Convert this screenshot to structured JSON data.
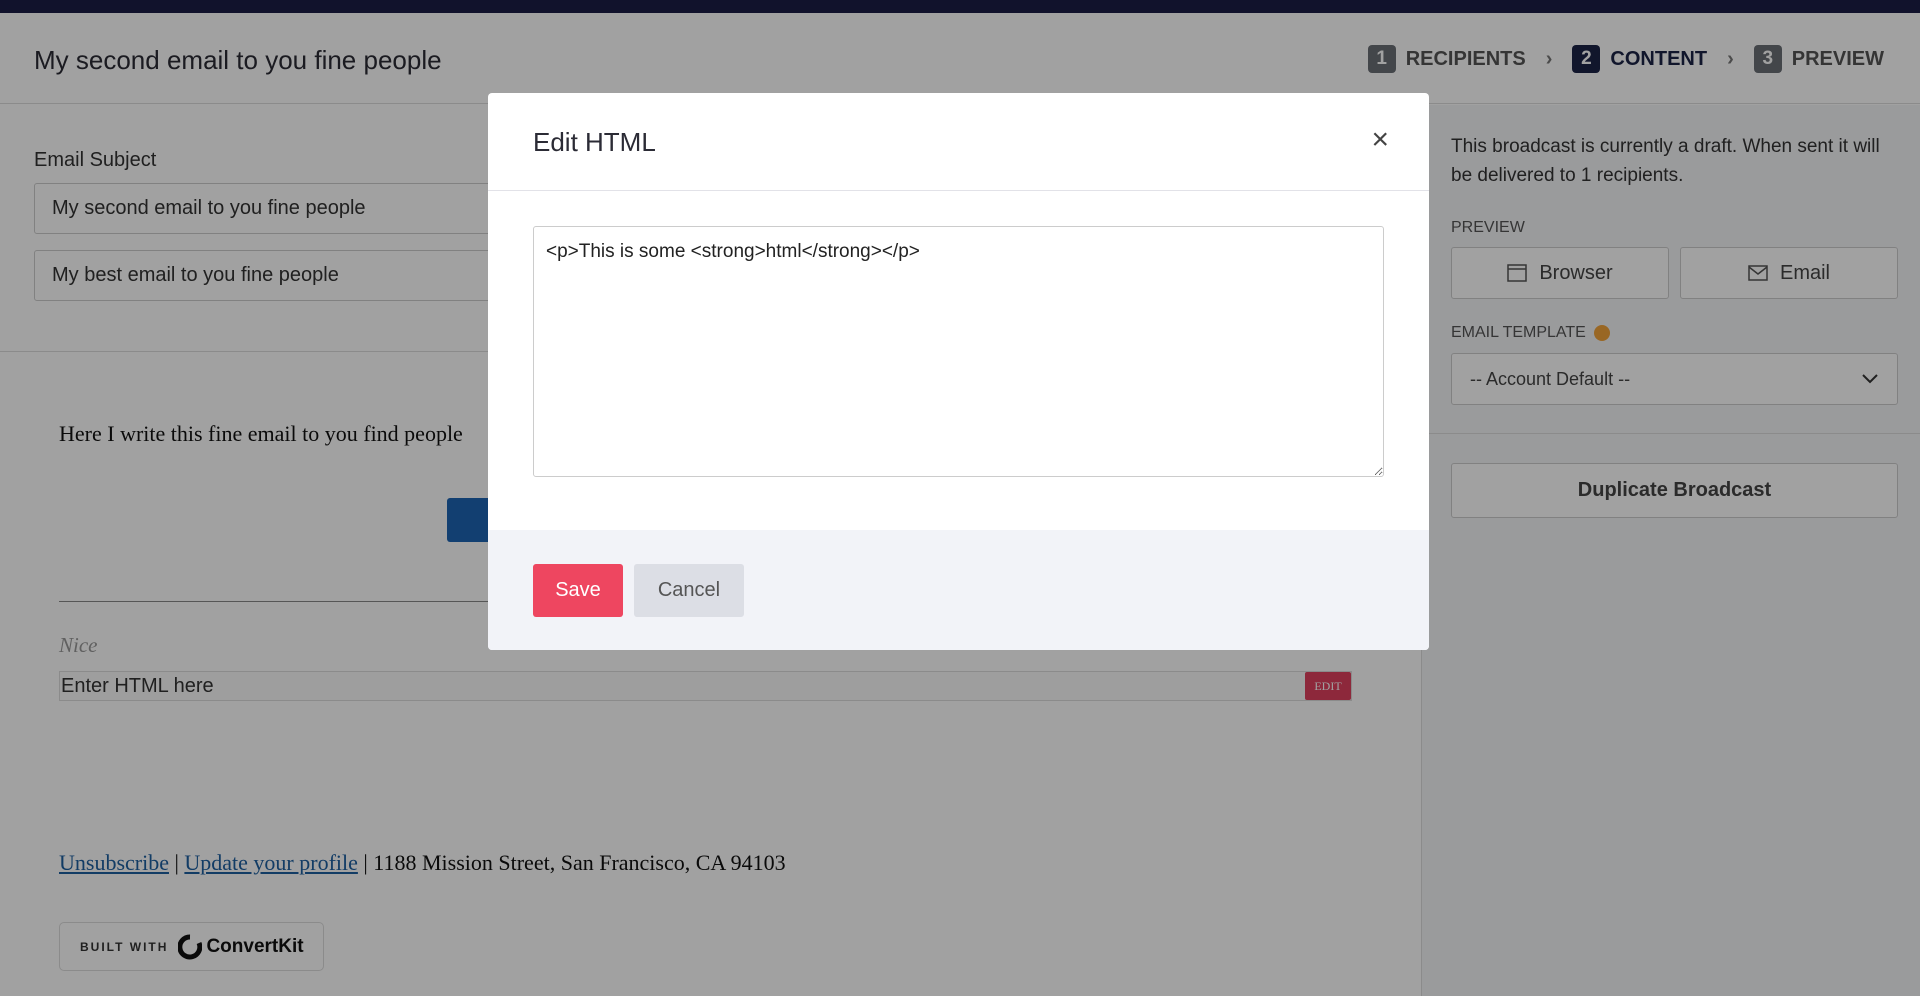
{
  "header": {
    "title": "My second email to you fine people",
    "steps": [
      {
        "num": "1",
        "label": "RECIPIENTS"
      },
      {
        "num": "2",
        "label": "CONTENT"
      },
      {
        "num": "3",
        "label": "PREVIEW"
      }
    ],
    "active_step": "CONTENT"
  },
  "main": {
    "subject_label": "Email Subject",
    "subject_value": "My second email to you fine people",
    "preview_text_value": "My best email to you fine people",
    "body_text": "Here I write this fine email to you find people",
    "nice_text": "Nice",
    "html_block_placeholder": "Enter HTML here",
    "edit_label": "EDIT",
    "footer": {
      "unsubscribe": "Unsubscribe",
      "sep1": " | ",
      "update_profile": "Update your profile",
      "address": " | 1188 Mission Street, San Francisco, CA 94103"
    },
    "badge": {
      "built_with": "BUILT WITH",
      "brand": "ConvertKit"
    }
  },
  "sidebar": {
    "draft_notice": "This broadcast is currently a draft. When sent it will be delivered to 1 recipients.",
    "preview_label": "PREVIEW",
    "browser_label": "Browser",
    "email_label": "Email",
    "template_label": "EMAIL TEMPLATE",
    "template_value": "-- Account Default --",
    "duplicate_label": "Duplicate Broadcast",
    "status_dot_color": "#f3a43a"
  },
  "modal": {
    "title": "Edit HTML",
    "html_value": "<p>This is some <strong>html</strong></p>",
    "save_label": "Save",
    "cancel_label": "Cancel"
  },
  "colors": {
    "accent": "#ee4660",
    "nav": "#1c2447",
    "link": "#1d5fa0"
  }
}
